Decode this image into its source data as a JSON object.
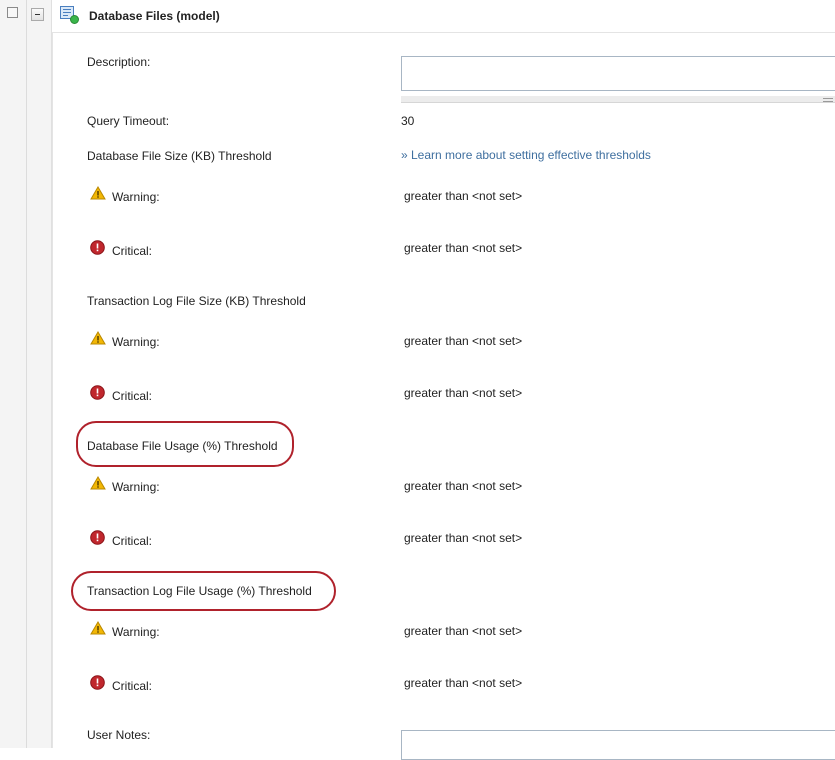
{
  "panel": {
    "title": "Database Files (model)"
  },
  "form": {
    "description_label": "Description:",
    "description_value": "",
    "query_timeout_label": "Query Timeout:",
    "query_timeout_value": "30",
    "learn_more_link": "» Learn more about setting effective thresholds",
    "user_notes_label": "User Notes:",
    "user_notes_value": ""
  },
  "thresholds": [
    {
      "title": "Database File Size (KB) Threshold",
      "warning_label": "Warning:",
      "warning_value": "greater than <not set>",
      "critical_label": "Critical:",
      "critical_value": "greater than <not set>",
      "circled": false
    },
    {
      "title": "Transaction Log File Size (KB) Threshold",
      "warning_label": "Warning:",
      "warning_value": "greater than <not set>",
      "critical_label": "Critical:",
      "critical_value": "greater than <not set>",
      "circled": false
    },
    {
      "title": "Database File Usage (%) Threshold",
      "warning_label": "Warning:",
      "warning_value": "greater than <not set>",
      "critical_label": "Critical:",
      "critical_value": "greater than <not set>",
      "circled": true
    },
    {
      "title": "Transaction Log File Usage (%) Threshold",
      "warning_label": "Warning:",
      "warning_value": "greater than <not set>",
      "critical_label": "Critical:",
      "critical_value": "greater than <not set>",
      "circled": true
    }
  ],
  "colors": {
    "accent_link": "#3f6f9f",
    "highlight_circle": "#b0222c",
    "warning_icon": "#f2b705",
    "critical_icon": "#c0272d",
    "status_dot": "#39b54a"
  },
  "icons": {
    "panel_icon": "database-files-icon",
    "warning": "warning-triangle-icon",
    "critical": "critical-circle-icon",
    "collapse": "collapse-minus-icon"
  }
}
